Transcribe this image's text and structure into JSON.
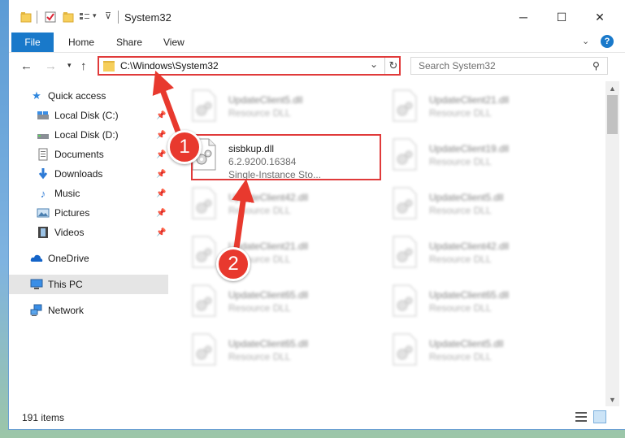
{
  "window": {
    "title": "System32",
    "controls": {
      "minimize": "─",
      "maximize": "☐",
      "close": "✕"
    }
  },
  "ribbon": {
    "file_label": "File",
    "tabs": [
      "Home",
      "Share",
      "View"
    ],
    "help_label": "?"
  },
  "navigation": {
    "address": "C:\\Windows\\System32",
    "search_placeholder": "Search System32"
  },
  "sidebar": {
    "items": [
      {
        "label": "Quick access",
        "icon": "star-icon"
      },
      {
        "label": "Local Disk (C:)",
        "icon": "drive-icon",
        "pinned": true
      },
      {
        "label": "Local Disk (D:)",
        "icon": "drive-icon",
        "pinned": true
      },
      {
        "label": "Documents",
        "icon": "documents-icon",
        "pinned": true
      },
      {
        "label": "Downloads",
        "icon": "downloads-icon",
        "pinned": true
      },
      {
        "label": "Music",
        "icon": "music-icon",
        "pinned": true
      },
      {
        "label": "Pictures",
        "icon": "pictures-icon",
        "pinned": true
      },
      {
        "label": "Videos",
        "icon": "videos-icon",
        "pinned": true
      },
      {
        "label": "OneDrive",
        "icon": "cloud-icon"
      },
      {
        "label": "This PC",
        "icon": "computer-icon",
        "selected": true
      },
      {
        "label": "Network",
        "icon": "network-icon"
      }
    ]
  },
  "files": {
    "left_column": [
      {
        "name": "UpdateClient5.dll",
        "type": "Resource DLL"
      },
      {
        "name": "sisbkup.dll",
        "version": "6.2.9200.16384",
        "description": "Single-Instance Sto...",
        "highlighted": true
      },
      {
        "name": "UpdateClient42.dll",
        "type": "Resource DLL"
      },
      {
        "name": "UpdateClient21.dll",
        "type": "Resource DLL"
      },
      {
        "name": "UpdateClient65.dll",
        "type": "Resource DLL"
      },
      {
        "name": "UpdateClient65.dll",
        "type": "Resource DLL"
      }
    ],
    "right_column": [
      {
        "name": "UpdateClient21.dll",
        "type": "Resource DLL"
      },
      {
        "name": "UpdateClient19.dll",
        "type": "Resource DLL"
      },
      {
        "name": "UpdateClient5.dll",
        "type": "Resource DLL"
      },
      {
        "name": "UpdateClient42.dll",
        "type": "Resource DLL"
      },
      {
        "name": "UpdateClient65.dll",
        "type": "Resource DLL"
      },
      {
        "name": "UpdateClient5.dll",
        "type": "Resource DLL"
      }
    ]
  },
  "status": {
    "item_count": "191 items"
  },
  "annotations": {
    "step1": "1",
    "step2": "2",
    "color": "#e8392e"
  }
}
